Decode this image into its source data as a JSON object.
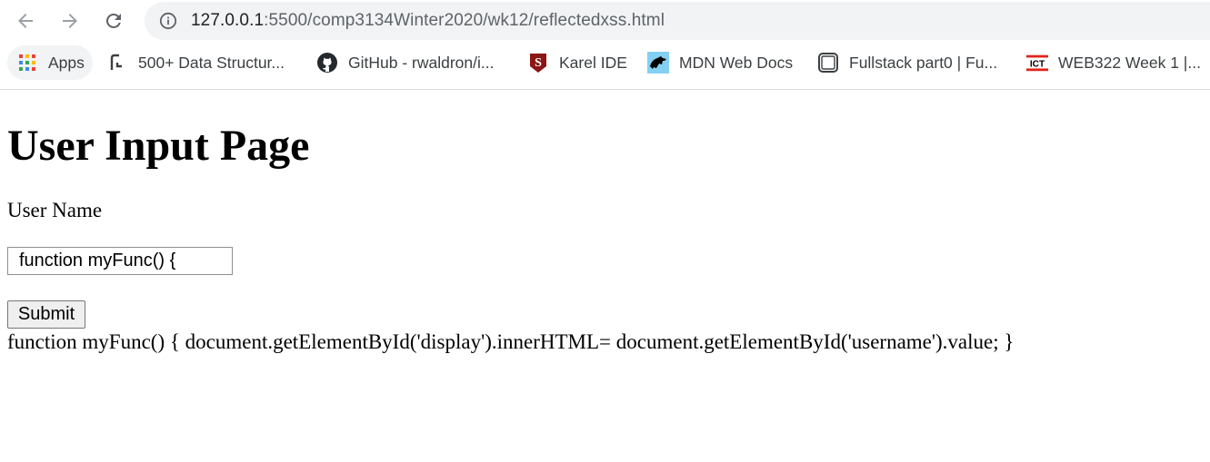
{
  "browser": {
    "url_host": "127.0.0.1",
    "url_path": ":5500/comp3134Winter2020/wk12/reflectedxss.html",
    "nav": {
      "back_icon": "arrow-left-icon",
      "forward_icon": "arrow-right-icon",
      "reload_icon": "reload-icon",
      "info_icon": "info-icon"
    },
    "bookmarks": [
      {
        "label": "Apps",
        "icon": "apps-grid-icon"
      },
      {
        "label": "500+ Data Structur...",
        "icon": "bracket-icon"
      },
      {
        "label": "GitHub - rwaldron/i...",
        "icon": "github-icon"
      },
      {
        "label": "Karel IDE",
        "icon": "stanford-icon"
      },
      {
        "label": "MDN Web Docs",
        "icon": "mdn-icon"
      },
      {
        "label": "Fullstack part0 | Fu...",
        "icon": "window-icon"
      },
      {
        "label": "WEB322 Week 1 |...",
        "icon": "ict-icon"
      }
    ]
  },
  "page": {
    "title": "User Input Page",
    "username_label": "User Name",
    "username_value": "function myFunc() {",
    "submit_label": "Submit",
    "display_text": "function myFunc() { document.getElementById('display').innerHTML= document.getElementById('username').value; }"
  },
  "colors": {
    "omnibox_bg": "#f1f3f4",
    "github": "#24292e",
    "stanford": "#8c1515",
    "ict_red": "#e2231a"
  }
}
